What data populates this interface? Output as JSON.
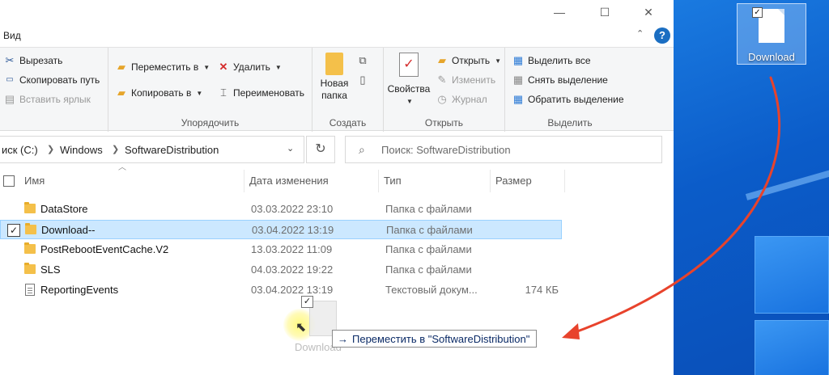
{
  "window": {
    "minimize": "—",
    "maximize": "☐",
    "close": "✕",
    "tab_view": "Вид",
    "collapse": "⌃",
    "help": "?"
  },
  "ribbon": {
    "clipboard": {
      "cut": "Вырезать",
      "copy_path": "Скопировать путь",
      "paste_shortcut": "Вставить ярлык"
    },
    "organize": {
      "label": "Упорядочить",
      "move_to": "Переместить в",
      "copy_to": "Копировать в",
      "delete": "Удалить",
      "rename": "Переименовать"
    },
    "create": {
      "label": "Создать",
      "new_folder_line1": "Новая",
      "new_folder_line2": "папка"
    },
    "open": {
      "label": "Открыть",
      "properties": "Свойства",
      "open": "Открыть",
      "edit": "Изменить",
      "history": "Журнал"
    },
    "select": {
      "label": "Выделить",
      "select_all": "Выделить все",
      "select_none": "Снять выделение",
      "invert": "Обратить выделение"
    }
  },
  "address": {
    "crumbs": [
      "иск (C:)",
      "Windows",
      "SoftwareDistribution"
    ],
    "search_placeholder": "Поиск: SoftwareDistribution"
  },
  "columns": {
    "name": "Имя",
    "date": "Дата изменения",
    "type": "Тип",
    "size": "Размер"
  },
  "rows": [
    {
      "name": "DataStore",
      "date": "03.03.2022 23:10",
      "type": "Папка с файлами",
      "size": "",
      "kind": "folder",
      "selected": false
    },
    {
      "name": "Download--",
      "date": "03.04.2022 13:19",
      "type": "Папка с файлами",
      "size": "",
      "kind": "folder",
      "selected": true
    },
    {
      "name": "PostRebootEventCache.V2",
      "date": "13.03.2022 11:09",
      "type": "Папка с файлами",
      "size": "",
      "kind": "folder",
      "selected": false
    },
    {
      "name": "SLS",
      "date": "04.03.2022 19:22",
      "type": "Папка с файлами",
      "size": "",
      "kind": "folder",
      "selected": false
    },
    {
      "name": "ReportingEvents",
      "date": "03.04.2022 13:19",
      "type": "Текстовый докум...",
      "size": "174 КБ",
      "kind": "file",
      "selected": false
    }
  ],
  "drag": {
    "ghost_label": "Download",
    "tooltip_arrow": "→",
    "tooltip_text": "Переместить в \"SoftwareDistribution\""
  },
  "desktop": {
    "icon_label": "Download"
  },
  "colors": {
    "accent": "#1b6ec2",
    "selection": "#cce8ff",
    "annotation_arrow": "#e8432c",
    "desktop": "#0b5cc9"
  }
}
